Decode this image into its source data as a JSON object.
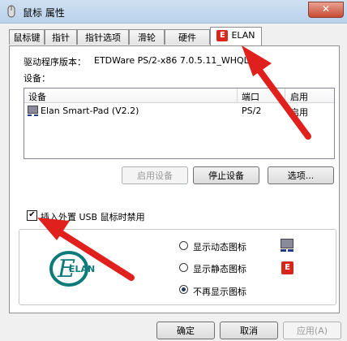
{
  "window": {
    "title": "鼠标 属性",
    "close_label": "✕"
  },
  "tabs": [
    {
      "label": "鼠标键"
    },
    {
      "label": "指针"
    },
    {
      "label": "指针选项"
    },
    {
      "label": "滑轮"
    },
    {
      "label": "硬件"
    },
    {
      "label": "ELAN"
    }
  ],
  "elan_tab": {
    "logo_letter": "E",
    "driver_version_label": "驱动程序版本：",
    "driver_version": "ETDWare PS/2-x86 7.0.5.11_WHQL",
    "devices_label": "设备：",
    "columns": [
      "设备",
      "端口",
      "启用"
    ],
    "devices": [
      {
        "name": "Elan Smart-Pad  (V2.2)",
        "port": "PS/2",
        "enabled": "启用"
      }
    ],
    "buttons": {
      "enable": "启用设备",
      "disable": "停止设备",
      "options": "选项..."
    },
    "usb_checkbox_label": "插入外置 USB 鼠标时禁用",
    "usb_checked": true,
    "elan_logo_text": "ELAN",
    "radios": [
      {
        "label": "显示动态图标",
        "checked": false
      },
      {
        "label": "显示静态图标",
        "checked": false
      },
      {
        "label": "不再显示图标",
        "checked": true
      }
    ]
  },
  "footer": {
    "ok": "确定",
    "cancel": "取消",
    "apply": "应用(A)"
  },
  "colors": {
    "accent_red": "#d9261c",
    "arrow_red": "#e0201c"
  }
}
